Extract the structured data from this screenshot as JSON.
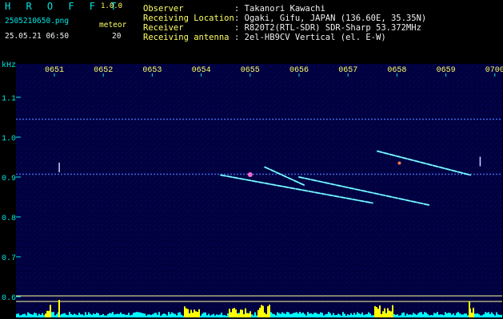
{
  "header": {
    "app_name": "H R O F F T",
    "version": "1.0.0",
    "filename": "2505210650.png",
    "datetime": "25.05.21 06:50",
    "meteor_label": "meteor",
    "meteor_count": "20",
    "info_labels": [
      "Observer",
      "Receiving Location",
      "Receiver",
      "Receiving antenna"
    ],
    "info_values": [
      ": Takanori Kawachi",
      ": Ogaki, Gifu, JAPAN (136.60E, 35.35N)",
      ": R820T2(RTL-SDR) SDR-Sharp 53.372MHz",
      ": 2el-HB9CV Vertical (el. E-W)"
    ]
  },
  "chart_data": {
    "type": "heatmap",
    "ylabel": "kHz",
    "time_ticks": [
      "0651",
      "0652",
      "0653",
      "0654",
      "0655",
      "0656",
      "0657",
      "0658",
      "0659",
      "0700"
    ],
    "freq_ticks": [
      "1.1",
      "1.0",
      "0.9",
      "0.8",
      "0.7",
      "0.6"
    ],
    "ylim": [
      0.58,
      1.2
    ],
    "steady_tones_khz": [
      1.045,
      0.907
    ],
    "meteor_traces": [
      {
        "from": [
          4.3,
          0.925
        ],
        "to": [
          5.1,
          0.88
        ]
      },
      {
        "from": [
          5.0,
          0.9
        ],
        "to": [
          7.65,
          0.83
        ]
      },
      {
        "from": [
          3.4,
          0.905
        ],
        "to": [
          6.5,
          0.835
        ]
      },
      {
        "from": [
          6.6,
          0.965
        ],
        "to": [
          8.5,
          0.905
        ]
      }
    ],
    "colors": {
      "background": "#000040",
      "text_cyan": "#00e6e6",
      "text_yellow": "#ffff66",
      "activity_bars": "#ffff00",
      "noise_floor": "#00ffff"
    }
  }
}
